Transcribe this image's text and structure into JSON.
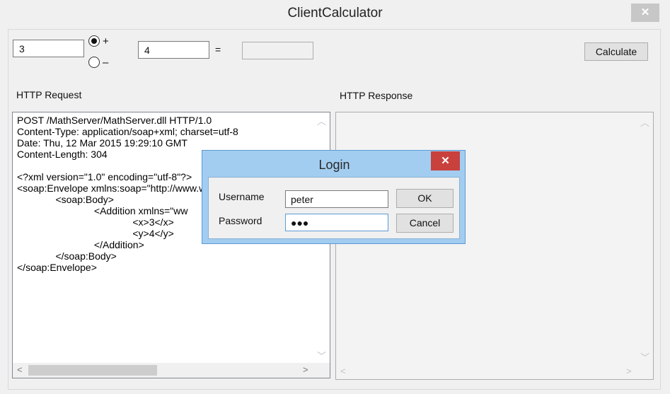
{
  "window": {
    "title": "ClientCalculator",
    "close_glyph": "✕"
  },
  "calculator": {
    "operand1": "3",
    "operand2": "4",
    "equals": "=",
    "result": "",
    "op_plus": "+",
    "op_minus": "–",
    "selected_op": "+",
    "calculate_label": "Calculate"
  },
  "request": {
    "label": "HTTP Request",
    "lines": [
      "POST /MathServer/MathServer.dll HTTP/1.0",
      "Content-Type: application/soap+xml; charset=utf-8",
      "Date: Thu, 12 Mar 2015 19:29:10 GMT",
      "Content-Length: 304",
      "",
      "<?xml version=\"1.0\" encoding=\"utf-8\"?>",
      "<soap:Envelope xmlns:soap=\"http://www.w",
      "              <soap:Body>",
      "                            <Addition xmlns=\"ww",
      "                                          <x>3</x>",
      "                                          <y>4</y>",
      "                            </Addition>",
      "              </soap:Body>",
      "</soap:Envelope>"
    ]
  },
  "response": {
    "label": "HTTP Response",
    "body": ""
  },
  "scroll_glyphs": {
    "up": "︿",
    "down": "﹀",
    "left": "<",
    "right": ">"
  },
  "login": {
    "title": "Login",
    "close_glyph": "✕",
    "username_label": "Username",
    "username_value": "peter",
    "password_label": "Password",
    "password_mask": "●●●",
    "ok_label": "OK",
    "cancel_label": "Cancel"
  },
  "colors": {
    "dialog_titlebar": "#a2cdf1",
    "dialog_close": "#c9413d",
    "focus_border": "#5b9bd5"
  }
}
